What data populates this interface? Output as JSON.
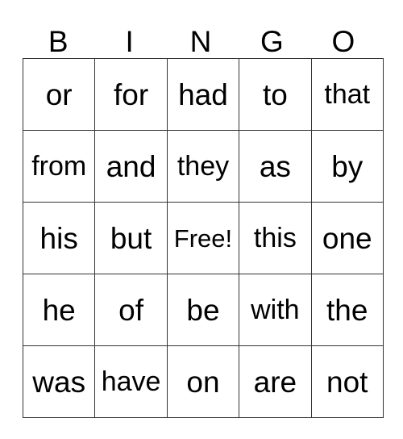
{
  "card": {
    "title": "BINGO",
    "free_space_label": "Free!",
    "colors": {
      "background": "#ffffff",
      "text": "#000000",
      "grid_line": "#333333"
    },
    "header": {
      "letters": [
        "B",
        "I",
        "N",
        "G",
        "O"
      ]
    },
    "grid": {
      "columns": 5,
      "rows": 5,
      "cells": [
        [
          "or",
          "for",
          "had",
          "to",
          "that"
        ],
        [
          "from",
          "and",
          "they",
          "as",
          "by"
        ],
        [
          "his",
          "but",
          "Free!",
          "this",
          "one"
        ],
        [
          "he",
          "of",
          "be",
          "with",
          "the"
        ],
        [
          "was",
          "have",
          "on",
          "are",
          "not"
        ]
      ]
    }
  }
}
